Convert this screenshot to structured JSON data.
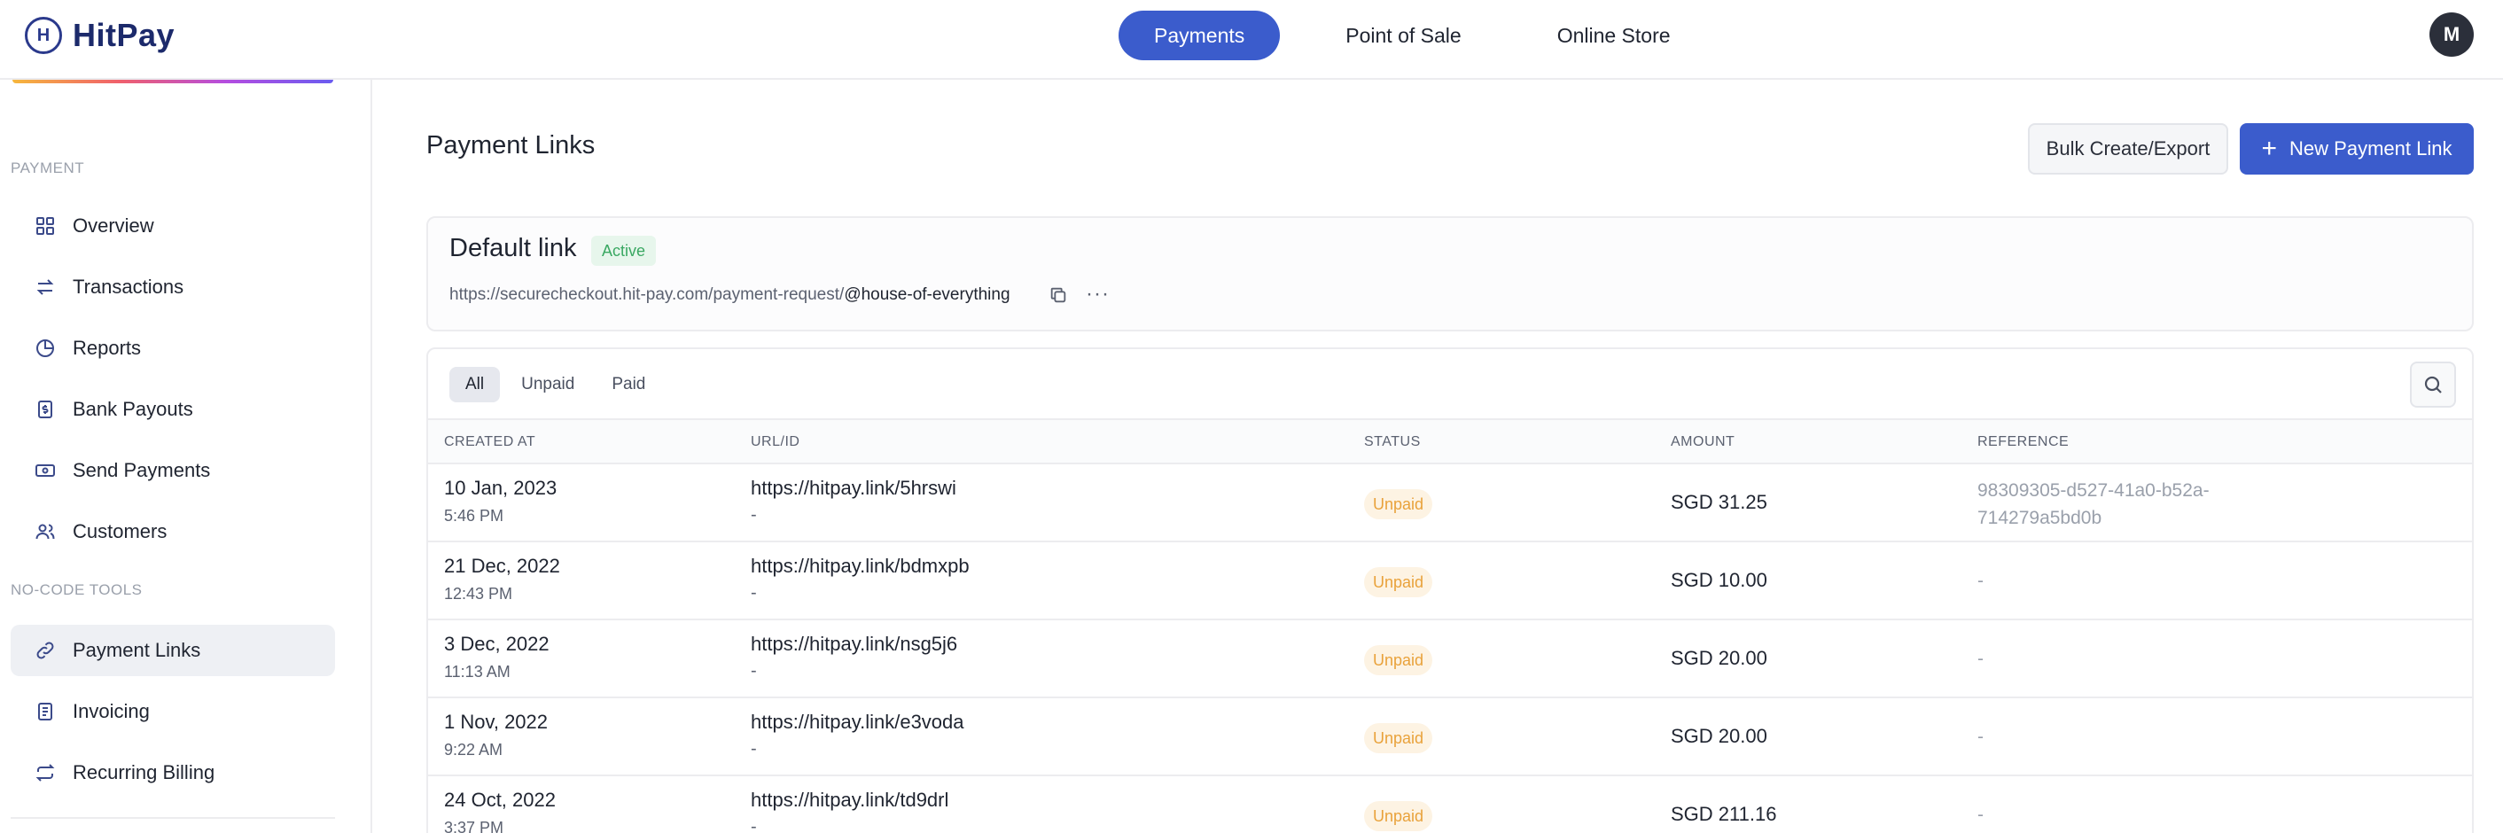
{
  "topbar": {
    "brand": "HitPay",
    "logo_letter": "H",
    "nav": [
      "Payments",
      "Point of Sale",
      "Online Store"
    ],
    "avatar_initial": "M"
  },
  "sidebar": {
    "section_payment": "PAYMENT",
    "payment_items": [
      "Overview",
      "Transactions",
      "Reports",
      "Bank Payouts",
      "Send Payments",
      "Customers"
    ],
    "section_nocode": "NO-CODE TOOLS",
    "nocode_items": [
      "Payment Links",
      "Invoicing",
      "Recurring Billing"
    ],
    "active_item": "Payment Links"
  },
  "main": {
    "title": "Payment Links",
    "bulk_button": "Bulk Create/Export",
    "new_button": "New Payment Link",
    "default_link": {
      "title": "Default link",
      "status": "Active",
      "url_base": "https://securecheckout.hit-pay.com/payment-request/",
      "url_slug": "@house-of-everything",
      "more": "···"
    },
    "filters": [
      "All",
      "Unpaid",
      "Paid"
    ],
    "columns": [
      "CREATED AT",
      "URL/ID",
      "STATUS",
      "AMOUNT",
      "REFERENCE"
    ],
    "rows": [
      {
        "date": "10 Jan, 2023",
        "time": "5:46 PM",
        "url": "https://hitpay.link/5hrswi",
        "id": "-",
        "status": "Unpaid",
        "amount": "SGD 31.25",
        "ref": "98309305-d527-41a0-b52a-714279a5bd0b"
      },
      {
        "date": "21 Dec, 2022",
        "time": "12:43 PM",
        "url": "https://hitpay.link/bdmxpb",
        "id": "-",
        "status": "Unpaid",
        "amount": "SGD 10.00",
        "ref": "-"
      },
      {
        "date": "3 Dec, 2022",
        "time": "11:13 AM",
        "url": "https://hitpay.link/nsg5j6",
        "id": "-",
        "status": "Unpaid",
        "amount": "SGD 20.00",
        "ref": "-"
      },
      {
        "date": "1 Nov, 2022",
        "time": "9:22 AM",
        "url": "https://hitpay.link/e3voda",
        "id": "-",
        "status": "Unpaid",
        "amount": "SGD 20.00",
        "ref": "-"
      },
      {
        "date": "24 Oct, 2022",
        "time": "3:37 PM",
        "url": "https://hitpay.link/td9drl",
        "id": "-",
        "status": "Unpaid",
        "amount": "SGD 211.16",
        "ref": "-"
      }
    ]
  },
  "colors": {
    "primary": "#3b5ccc",
    "active_badge_bg": "#e7f6ec",
    "active_badge_text": "#3aa862",
    "unpaid_badge_bg": "#fdf3e3",
    "unpaid_badge_text": "#e9a23b"
  },
  "icons": {
    "overview": "grid-icon",
    "transactions": "arrows-swap-icon",
    "reports": "pie-chart-icon",
    "bank_payouts": "bank-note-icon",
    "send_payments": "cash-icon",
    "customers": "users-icon",
    "payment_links": "link-icon",
    "invoicing": "invoice-icon",
    "recurring_billing": "repeat-icon"
  }
}
